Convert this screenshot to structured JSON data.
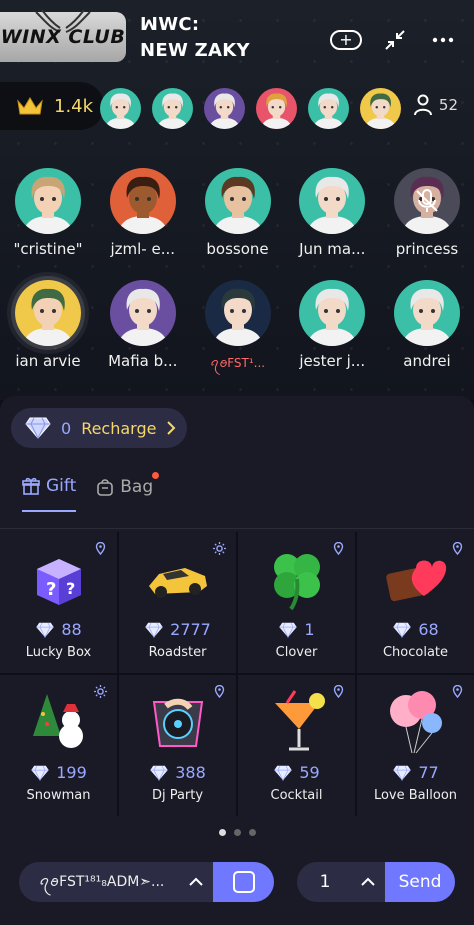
{
  "room": {
    "badge_text": "WINX CLUB",
    "title_line1": "WC:",
    "title_line2": "NEW ZAKY",
    "crown_value": "1.4k",
    "viewer_count": "52"
  },
  "seats_row1": [
    {
      "name": "\"cristine\"",
      "skin": "#f3d1b5",
      "hair": "#c9a575",
      "bg": "#3bbfa7"
    },
    {
      "name": "jzml- e...",
      "skin": "#9c5a2e",
      "hair": "#3a1e12",
      "bg": "#e0603a"
    },
    {
      "name": "bossone",
      "skin": "#e8c2a0",
      "hair": "#5a3a22",
      "bg": "#3bbfa7"
    },
    {
      "name": "Jun ma...",
      "skin": "#f3d9c8",
      "hair": "#e8e8e8",
      "bg": "#3bbfa7"
    },
    {
      "name": "princess",
      "skin": "#d6b0a0",
      "hair": "#5a2d52",
      "bg": "#4a4a58"
    }
  ],
  "seats_row2": [
    {
      "name": "ian arvie",
      "skin": "#f3d1b5",
      "hair": "#3f6a44",
      "bg": "#f0c84a"
    },
    {
      "name": "Mafia b...",
      "skin": "#f3d9c8",
      "hair": "#e8e8e8",
      "bg": "#6a4fa0"
    },
    {
      "name": "ꪖꪮFST¹...",
      "skin": "#f3d9c8",
      "hair": "#2a3a3a",
      "bg": "#1b2a44"
    },
    {
      "name": "jester j...",
      "skin": "#f3d9c8",
      "hair": "#e8e8e8",
      "bg": "#3bbfa7"
    },
    {
      "name": "andrei",
      "skin": "#f3d9c8",
      "hair": "#e8e8e8",
      "bg": "#3bbfa7"
    }
  ],
  "viewers": [
    {
      "hair": "#e8e8e8",
      "bg": "#3bbfa7"
    },
    {
      "hair": "#e8e8e8",
      "bg": "#3bbfa7"
    },
    {
      "hair": "#e8e8e8",
      "bg": "#6a4fa0"
    },
    {
      "hair": "#e0a040",
      "bg": "#e8546a"
    },
    {
      "hair": "#e8e8e8",
      "bg": "#3bbfa7"
    },
    {
      "hair": "#3f6a44",
      "bg": "#f0c84a"
    }
  ],
  "recharge": {
    "balance": "0",
    "label": "Recharge"
  },
  "tabs": {
    "gift": "Gift",
    "bag": "Bag"
  },
  "gifts": [
    {
      "name": "Lucky Box",
      "price": "88",
      "corner": "pin-icon"
    },
    {
      "name": "Roadster",
      "price": "2777",
      "corner": "sun-icon"
    },
    {
      "name": "Clover",
      "price": "1",
      "corner": "pin-icon"
    },
    {
      "name": "Chocolate",
      "price": "68",
      "corner": "pin-icon"
    },
    {
      "name": "Snowman",
      "price": "199",
      "corner": "sun-icon"
    },
    {
      "name": "Dj Party",
      "price": "388",
      "corner": "pin-icon"
    },
    {
      "name": "Cocktail",
      "price": "59",
      "corner": "pin-icon"
    },
    {
      "name": "Love Balloon",
      "price": "77",
      "corner": "pin-icon"
    }
  ],
  "bottom": {
    "recipient": "ꪖꪮFST¹⁸¹₈ADM➣...",
    "quantity": "1",
    "send": "Send"
  },
  "colors": {
    "accent": "#6f78ff",
    "gold": "#f4d86b",
    "price": "#9aa8ff"
  }
}
